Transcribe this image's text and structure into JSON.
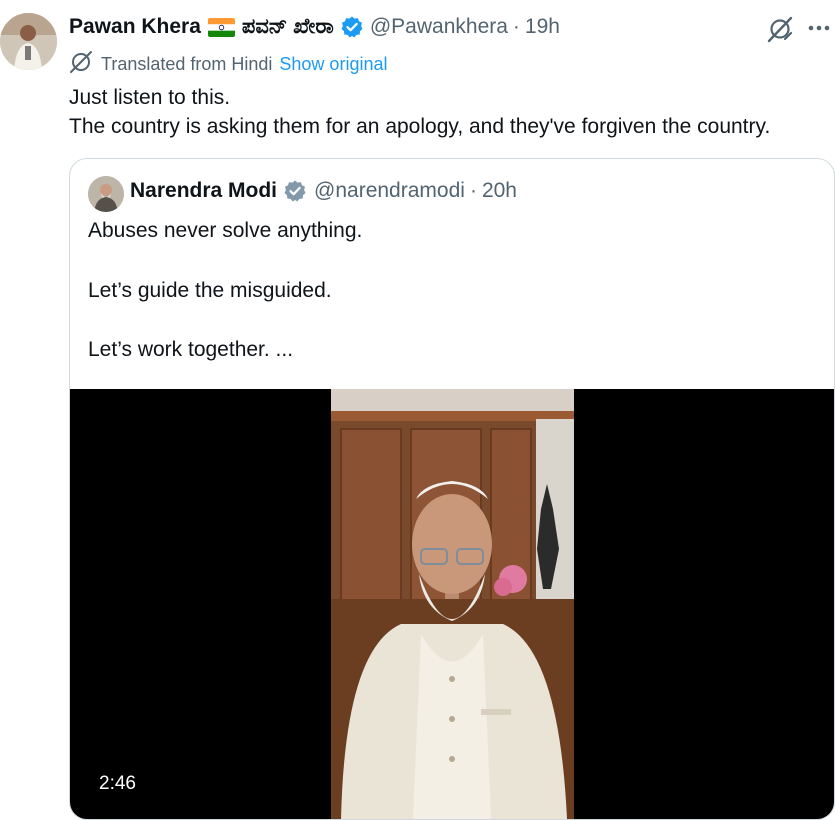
{
  "tweet": {
    "author_name": "Pawan Khera",
    "author_alt_name": "ಪವನ್ ಖೇರಾ",
    "handle": "@Pawankhera",
    "separator": "·",
    "time": "19h",
    "translated_label": "Translated from Hindi",
    "show_original": "Show original",
    "text_lines": [
      "Just listen to this.",
      "The country is asking them for an apology, and they've forgiven the country."
    ]
  },
  "quoted": {
    "author_name": "Narendra Modi",
    "handle": "@narendramodi",
    "separator": "·",
    "time": "20h",
    "text_lines": [
      "Abuses never solve anything.",
      "Let’s guide the misguided.",
      "Let’s work together. ..."
    ],
    "video": {
      "duration": "2:46"
    }
  },
  "colors": {
    "verified": "#1d9bf0",
    "quoted_verified": "#829aab",
    "link": "#1d9bf0",
    "muted": "#536471"
  },
  "icons": [
    "india-flag-icon",
    "verified-badge-icon",
    "grok-icon",
    "more-icon",
    "translate-icon"
  ]
}
